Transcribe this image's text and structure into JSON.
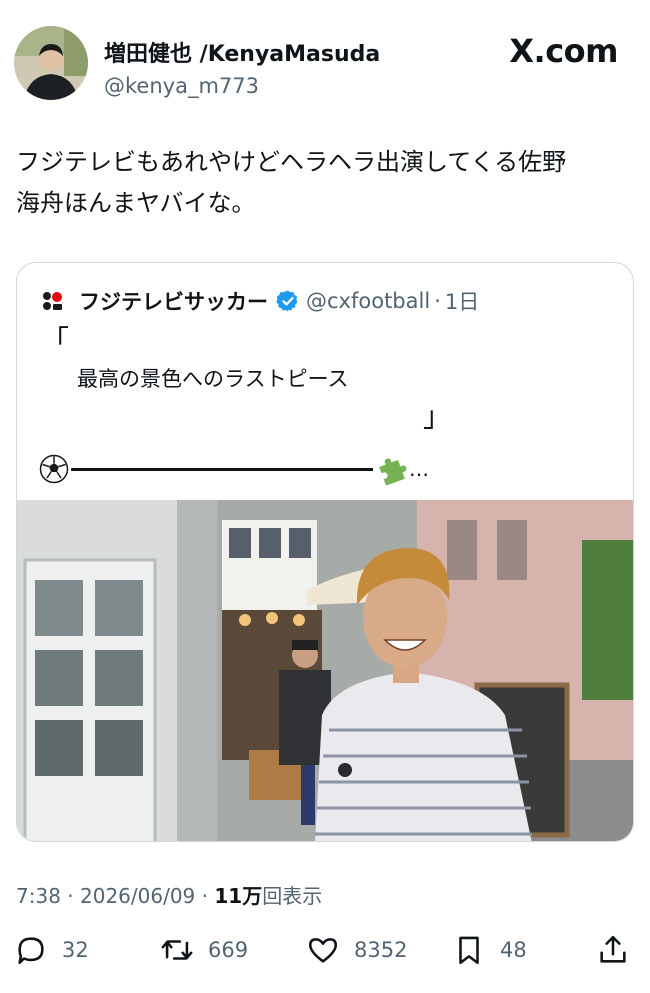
{
  "author": {
    "display_name": "増田健也 /KenyaMasuda",
    "handle": "@kenya_m773"
  },
  "brand": "X.com",
  "tweet": {
    "text_line1": "フジテレビもあれやけどヘラヘラ出演してくる佐野",
    "text_line2": "海舟ほんまヤバイな。"
  },
  "quote": {
    "display_name": "フジテレビサッカー",
    "handle": "@cxfootball",
    "separator": "·",
    "age": "1日",
    "bracket_open": "「",
    "bracket_close": "」",
    "line": "最高の景色へのラストピース",
    "ellipsis": "…"
  },
  "meta": {
    "time": "7:38",
    "sep": " · ",
    "date": "2026/06/09",
    "views_number": "11万",
    "views_label": "回表示"
  },
  "actions": {
    "replies": "32",
    "retweets": "669",
    "likes": "8352",
    "bookmarks": "48"
  },
  "colors": {
    "text": "#0f1419",
    "secondary": "#536471",
    "border": "#cfd9de",
    "verified": "#1d9bf0"
  }
}
